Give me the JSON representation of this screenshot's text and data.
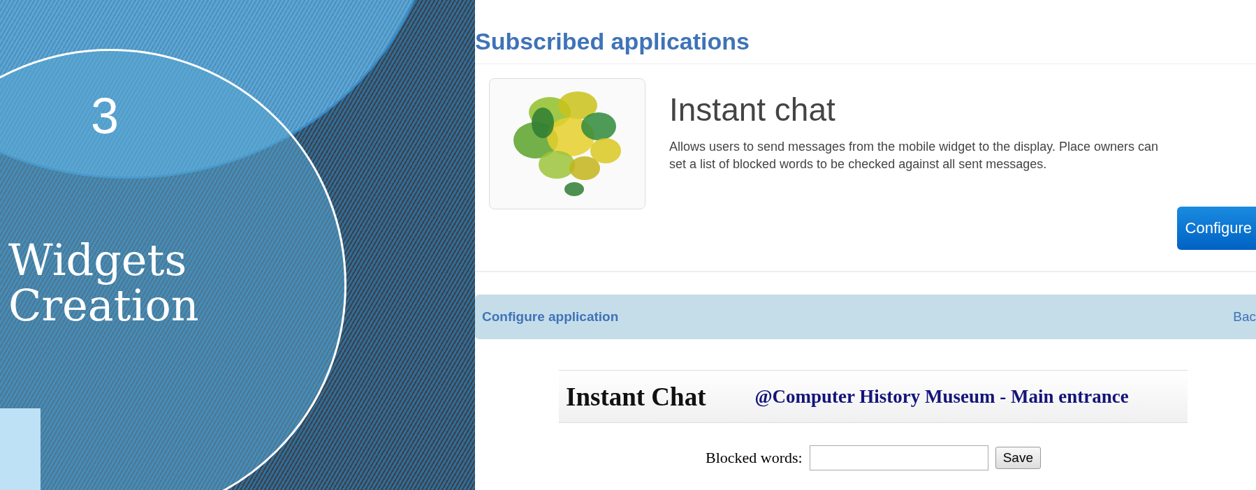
{
  "slide": {
    "number": "3",
    "title": "Widgets Creation"
  },
  "page": {
    "heading": "Subscribed applications",
    "app": {
      "title": "Instant chat",
      "description": "Allows users to send messages from the mobile widget to the display. Place owners can set a list of blocked words to be checked against all sent messages.",
      "configure_button": "Configure"
    },
    "config_bar": {
      "title": "Configure application",
      "back_link": "Bac"
    },
    "widget": {
      "title": "Instant Chat",
      "location": "@Computer History Museum - Main entrance",
      "blocked_label": "Blocked words:",
      "save_button": "Save"
    }
  }
}
